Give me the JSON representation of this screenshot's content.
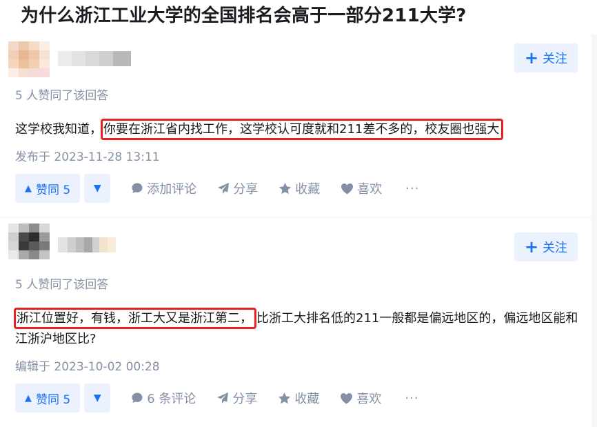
{
  "question": {
    "title": "为什么浙江工业大学的全国排名会高于一部分211大学?"
  },
  "answers": [
    {
      "follow_label": "关注",
      "agree_text": "5 人赞同了该回答",
      "content_before": "这学校我知道，",
      "content_highlight": "你要在浙江省内找工作，这学校认可度就和211差不多的，校友圈也强大",
      "content_after": "",
      "date": "发布于 2023-11-28 13:11",
      "vote_label": "赞同 5",
      "comment_label": "添加评论",
      "share_label": "分享",
      "collect_label": "收藏",
      "like_label": "喜欢",
      "more_label": "···"
    },
    {
      "follow_label": "关注",
      "agree_text": "5 人赞同了该回答",
      "content_before": "",
      "content_highlight": "浙江位置好，有钱，浙工大又是浙江第二，",
      "content_after": "比浙工大排名低的211一般都是偏远地区的，偏远地区能和江浙沪地区比?",
      "date": "编辑于 2023-10-02 00:28",
      "vote_label": "赞同 5",
      "comment_label": "6 条评论",
      "share_label": "分享",
      "collect_label": "收藏",
      "like_label": "喜欢",
      "more_label": "···"
    }
  ],
  "colors": {
    "accent": "#1772f6",
    "accent_bg": "#ebf2fd",
    "meta_gray": "#8491a5",
    "highlight_border": "#e82020"
  },
  "icons": {
    "follow": "plus-icon",
    "vote_up": "triangle-up-icon",
    "vote_down": "triangle-down-icon",
    "comment": "comment-bubble-icon",
    "share": "paper-plane-icon",
    "collect": "star-icon",
    "like": "heart-icon"
  }
}
